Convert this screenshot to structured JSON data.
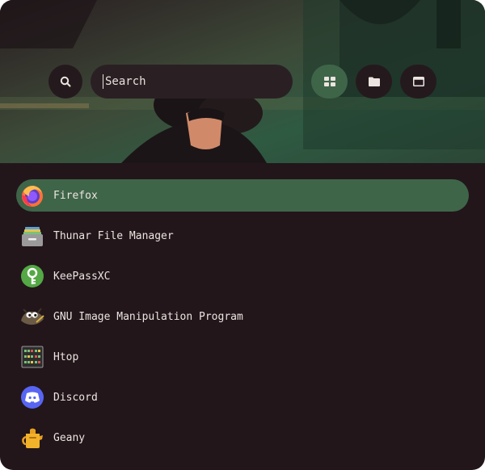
{
  "search": {
    "placeholder": "Search",
    "value": ""
  },
  "modes": [
    {
      "name": "apps",
      "icon": "grid-icon",
      "active": true
    },
    {
      "name": "files",
      "icon": "folder-icon",
      "active": false
    },
    {
      "name": "windows",
      "icon": "window-icon",
      "active": false
    }
  ],
  "apps": [
    {
      "label": "Firefox",
      "icon": "firefox-icon",
      "selected": true
    },
    {
      "label": "Thunar File Manager",
      "icon": "thunar-icon",
      "selected": false
    },
    {
      "label": "KeePassXC",
      "icon": "keepassxc-icon",
      "selected": false
    },
    {
      "label": "GNU Image Manipulation Program",
      "icon": "gimp-icon",
      "selected": false
    },
    {
      "label": "Htop",
      "icon": "htop-icon",
      "selected": false
    },
    {
      "label": "Discord",
      "icon": "discord-icon",
      "selected": false
    },
    {
      "label": "Geany",
      "icon": "geany-icon",
      "selected": false
    }
  ],
  "colors": {
    "background": "#22161b",
    "accent": "#3f6549",
    "text": "#ece4e0"
  }
}
